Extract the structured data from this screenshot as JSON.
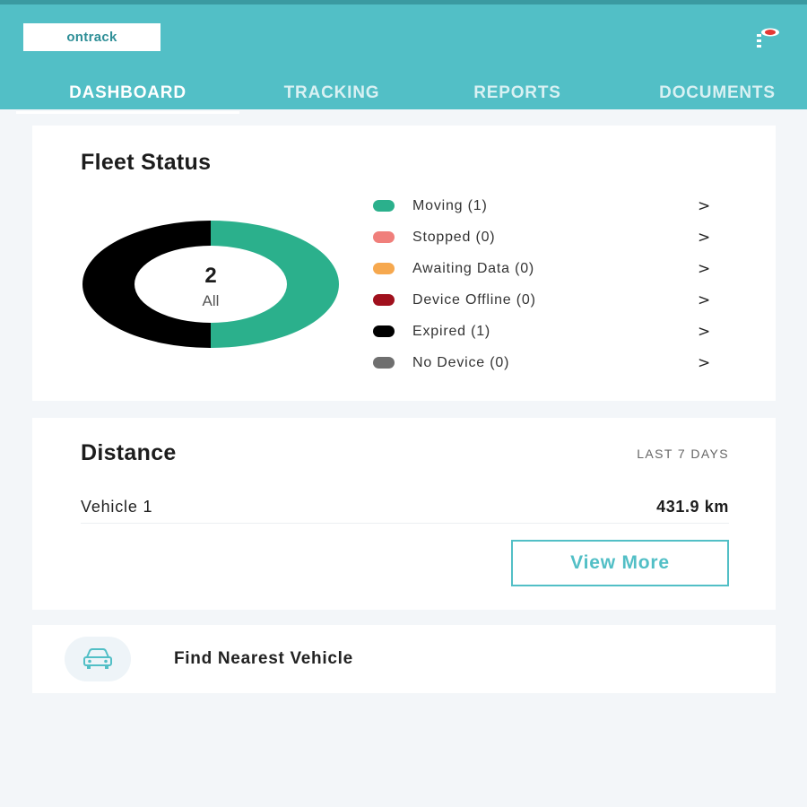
{
  "header": {
    "logo_text": "ontrack",
    "accent_color": "#52bfc6",
    "menu_icon": "menu-dots-icon",
    "notification_color": "#e53935"
  },
  "tabs": [
    {
      "label": "DASHBOARD",
      "active": true
    },
    {
      "label": "TRACKING",
      "active": false
    },
    {
      "label": "REPORTS",
      "active": false
    },
    {
      "label": "DOCUMENTS",
      "active": false
    }
  ],
  "fleet_status": {
    "title": "Fleet Status",
    "total": "2",
    "total_label": "All",
    "legend": [
      {
        "label": "Moving (1)",
        "color": "#2bb08c",
        "count": 1
      },
      {
        "label": "Stopped (0)",
        "color": "#f07f7b",
        "count": 0
      },
      {
        "label": "Awaiting Data (0)",
        "color": "#f6a84e",
        "count": 0
      },
      {
        "label": "Device Offline (0)",
        "color": "#a0101d",
        "count": 0
      },
      {
        "label": "Expired (1)",
        "color": "#000000",
        "count": 1
      },
      {
        "label": "No Device (0)",
        "color": "#6f6f6f",
        "count": 0
      }
    ],
    "chevron": ">"
  },
  "distance": {
    "title": "Distance",
    "period": "LAST 7 DAYS",
    "rows": [
      {
        "vehicle": "Vehicle 1",
        "distance": "431.9 km"
      }
    ],
    "view_more_label": "View More"
  },
  "find_nearest": {
    "label": "Find Nearest Vehicle",
    "icon": "car-icon"
  }
}
